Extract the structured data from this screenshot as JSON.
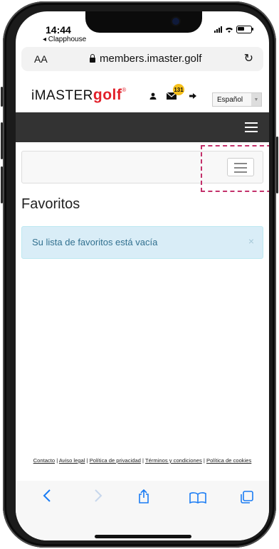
{
  "status_bar": {
    "time": "14:44",
    "back_app": "◂ Clapphouse"
  },
  "browser": {
    "text_size": "AA",
    "url": "members.imaster.golf",
    "reload_icon": "reload-icon"
  },
  "site": {
    "logo": {
      "part1": "iMASTER",
      "part2": "golf",
      "trademark": "®"
    },
    "notification_count": "131",
    "language": "Español"
  },
  "page": {
    "title": "Favoritos",
    "alert_message": "Su lista de favoritos está vacía",
    "alert_close": "×"
  },
  "footer": {
    "links": [
      "Contacto",
      "Aviso legal",
      "Política de privacidad",
      "Términos y condiciones",
      "Política de cookies"
    ],
    "separator": "|"
  },
  "toolbar_icons": [
    "back-icon",
    "forward-icon",
    "share-icon",
    "bookmarks-icon",
    "tabs-icon"
  ],
  "colors": {
    "brand_red": "#e2202a",
    "ios_blue": "#1a7cf4",
    "alert_bg": "#d9edf7",
    "alert_text": "#31708f",
    "nav_dark": "#333333",
    "annotation": "#c3306a"
  }
}
